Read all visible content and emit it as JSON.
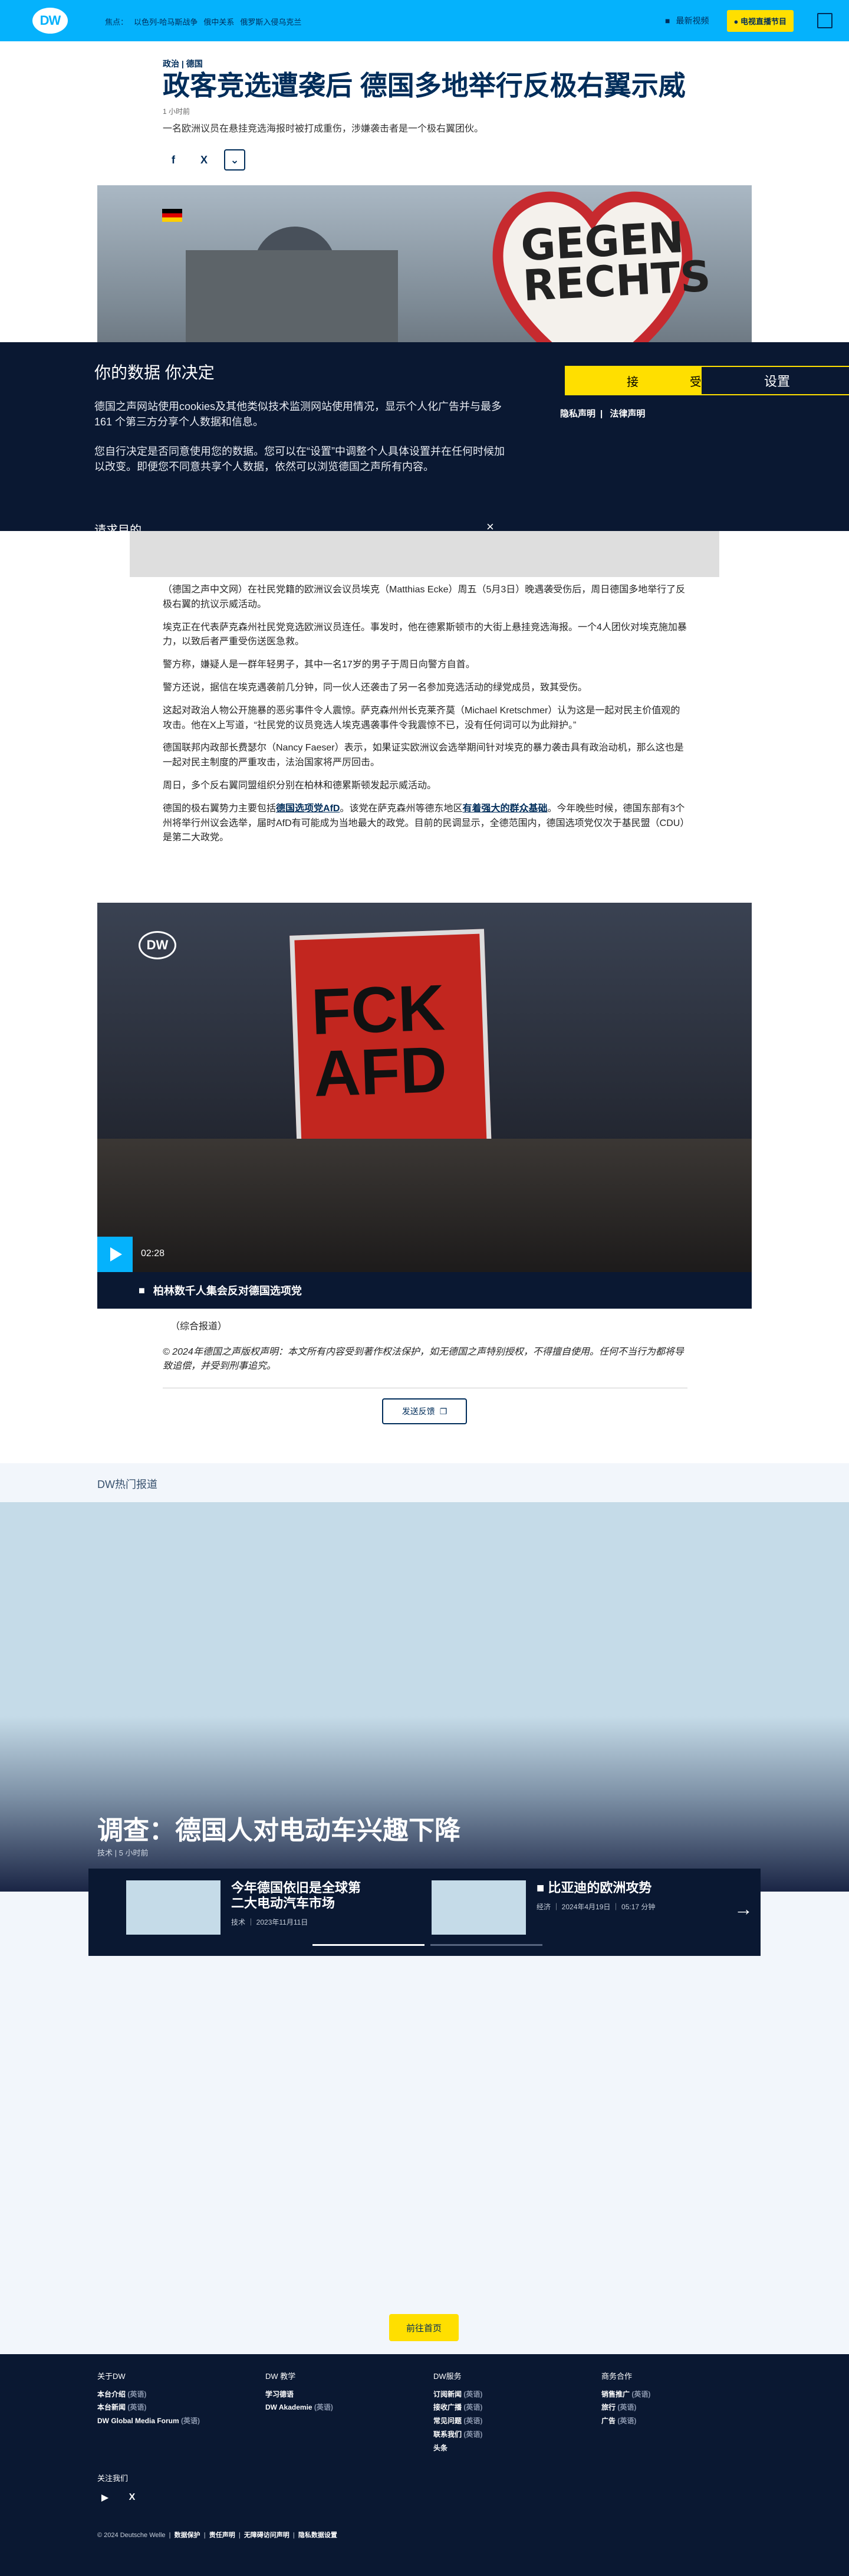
{
  "header": {
    "logo": "DW",
    "nav_label": "焦点：",
    "nav_links": [
      "以色列-哈马斯战争",
      "俄中关系",
      "俄罗斯入侵乌克兰"
    ],
    "latest_video": "最新视频",
    "tv_button": "电视直播节目",
    "bg_color": "#05b2fc"
  },
  "article": {
    "kicker": "政治 | 德国",
    "headline": "政客竞选遭袭后 德国多地举行反极右翼示威",
    "time_ago": "1 小时前",
    "teaser": "一名欧洲议员在悬挂竞选海报时被打成重伤，涉嫌袭击者是一个极右翼团伙。",
    "share": [
      "f",
      "X"
    ],
    "hero_sign": [
      "GEGEN",
      "RECHTS"
    ],
    "paragraphs": [
      "（德国之声中文网）在社民党籍的欧洲议会议员埃克（Matthias Ecke）周五（5月3日）晚遇袭受伤后，周日德国多地举行了反极右翼的抗议示威活动。",
      "埃克正在代表萨克森州社民党竞选欧洲议员连任。事发时，他在德累斯顿市的大街上悬挂竞选海报。一个4人团伙对埃克施加暴力，以致后者严重受伤送医急救。",
      "警方称，嫌疑人是一群年轻男子，其中一名17岁的男子于周日向警方自首。",
      "警方还说，据信在埃克遇袭前几分钟，同一伙人还袭击了另一名参加竞选活动的绿党成员，致其受伤。",
      "这起对政治人物公开施暴的恶劣事件令人震惊。萨克森州州长克莱齐莫（Michael Kretschmer）认为这是一起对民主价值观的攻击。他在X上写道，“社民党的议员竞选人埃克遇袭事件令我震惊不已，没有任何词可以为此辩护。”",
      "德国联邦内政部长费瑟尔（Nancy Faeser）表示，如果证实欧洲议会选举期间针对埃克的暴力袭击具有政治动机，那么这也是一起对民主制度的严重攻击，法治国家将严厉回击。",
      "周日，多个反右翼同盟组织分别在柏林和德累斯顿发起示威活动。"
    ],
    "last_paragraph_parts": [
      "德国的极右翼势力主要包括",
      "德国选项党AfD",
      "。该党在萨克森州等德东地区",
      "有着强大的群众基础",
      "。今年晚些时候，德国东部有3个州将举行州议会选举，届时AfD有可能成为当地最大的政党。目前的民调显示，全德范围内，德国选项党仅次于基民盟（CDU）是第二大政党。"
    ],
    "video": {
      "duration": "02:28",
      "caption": "柏林数千人集会反对德国选项党",
      "poster_text": [
        "FCK",
        "AFD"
      ],
      "logo": "DW"
    },
    "source": "（综合报道）",
    "copyright": "© 2024年德国之声版权声明：本文所有内容受到著作权法保护，如无德国之声特别授权，不得擅自使用。任何不当行为都将导致追偿，并受到刑事追究。",
    "feedback": "发送反馈"
  },
  "consent": {
    "title": "你的数据 你决定",
    "p1": "德国之声网站使用cookies及其他类似技术监测网站使用情况，显示个人化广告并与最多161 个第三方分享个人数据和信息。",
    "p2": "您自行决定是否同意使用您的数据。您可以在“设置”中调整个人具体设置并在任何时候加以改变。即便您不同意共享个人数据，依然可以浏览德国之声所有内容。",
    "purpose": "请求目的",
    "accept": "接",
    "accept_tail": "受",
    "settings": "设置",
    "privacy": "隐私声明",
    "legal": "法律声明"
  },
  "popular": {
    "title": "DW热门报道",
    "main": {
      "headline": "调查：德国人对电动车兴趣下降",
      "meta": "技术 | 5 小时前"
    },
    "slides": [
      {
        "headline": "今年德国依旧是全球第二大电动汽车市场",
        "meta": "技术 ｜ 2023年11月11日"
      },
      {
        "headline": "比亚迪的欧洲攻势",
        "meta": "经济 ｜ 2024年4月19日 ｜ 05:17 分钟"
      }
    ],
    "home_button": "前往首页"
  },
  "footer": {
    "cols": [
      {
        "title": "关于DW",
        "items": [
          "本台介绍",
          "本台新闻",
          "DW Global Media Forum"
        ],
        "ext": [
          "(英语)",
          "(英语)",
          "(英语)"
        ]
      },
      {
        "title": "DW 教学",
        "items": [
          "学习德语",
          "DW Akademie"
        ],
        "ext": [
          "",
          "(英语)"
        ]
      },
      {
        "title": "DW服务",
        "items": [
          "订阅新闻",
          "接收广播",
          "常见问题",
          "联系我们",
          "头条"
        ],
        "ext": [
          "(英语)",
          "(英语)",
          "(英语)",
          "(英语)",
          ""
        ]
      },
      {
        "title": "商务合作",
        "items": [
          "销售推广",
          "旅行",
          "广告"
        ],
        "ext": [
          "(英语)",
          "(英语)",
          "(英语)"
        ]
      }
    ],
    "follow": "关注我们",
    "legal_prefix": "© 2024 Deutsche Welle",
    "legal_links": [
      "数据保护",
      "责任声明",
      "无障碍访问声明",
      "隐私数据设置"
    ]
  }
}
